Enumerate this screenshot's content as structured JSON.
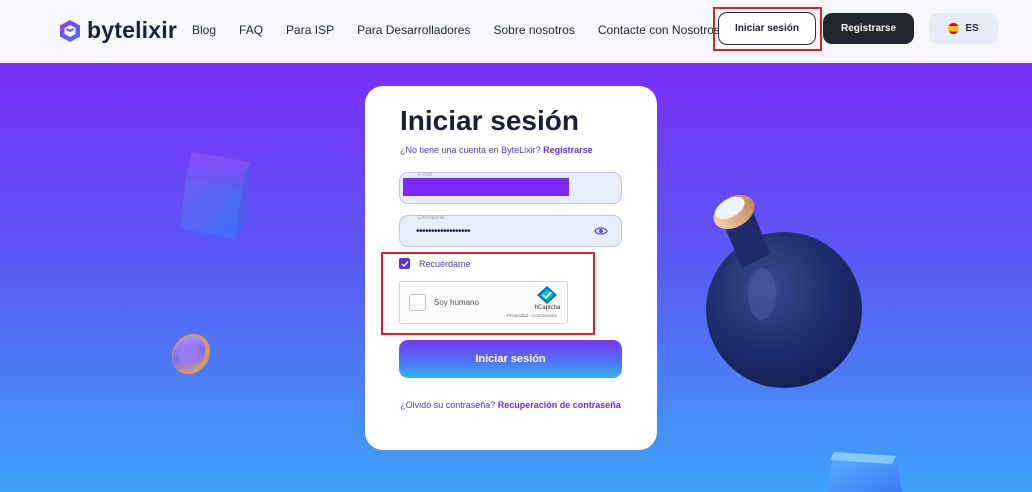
{
  "header": {
    "logo_text": "bytelixir",
    "nav": [
      "Blog",
      "FAQ",
      "Para ISP",
      "Para Desarrolladores",
      "Sobre nosotros",
      "Contacte con Nosotros"
    ],
    "login_label": "Iniciar sesión",
    "register_label": "Registrarse",
    "language": "ES"
  },
  "card": {
    "title": "Iniciar sesión",
    "no_account_text": "¿No tiene una cuenta en ByteLixir?",
    "register_link": "Registrarse",
    "email_label": "E-mail",
    "password_label": "Contraseña",
    "password_value": "••••••••••••••••••",
    "remember_label": "Recuérdame",
    "remember_checked": true,
    "captcha_label": "Soy humano",
    "captcha_brand": "hCaptcha",
    "captcha_links": "Privacidad - Condiciones",
    "submit_label": "Iniciar sesión",
    "forgot_text": "¿Olvidó su contraseña?",
    "recovery_link": "Recuperación de contraseña"
  },
  "colors": {
    "brand_purple": "#7b2ff7",
    "brand_blue": "#3ea3f8",
    "highlight_red": "#d8232e",
    "dark_button": "#22242f"
  }
}
